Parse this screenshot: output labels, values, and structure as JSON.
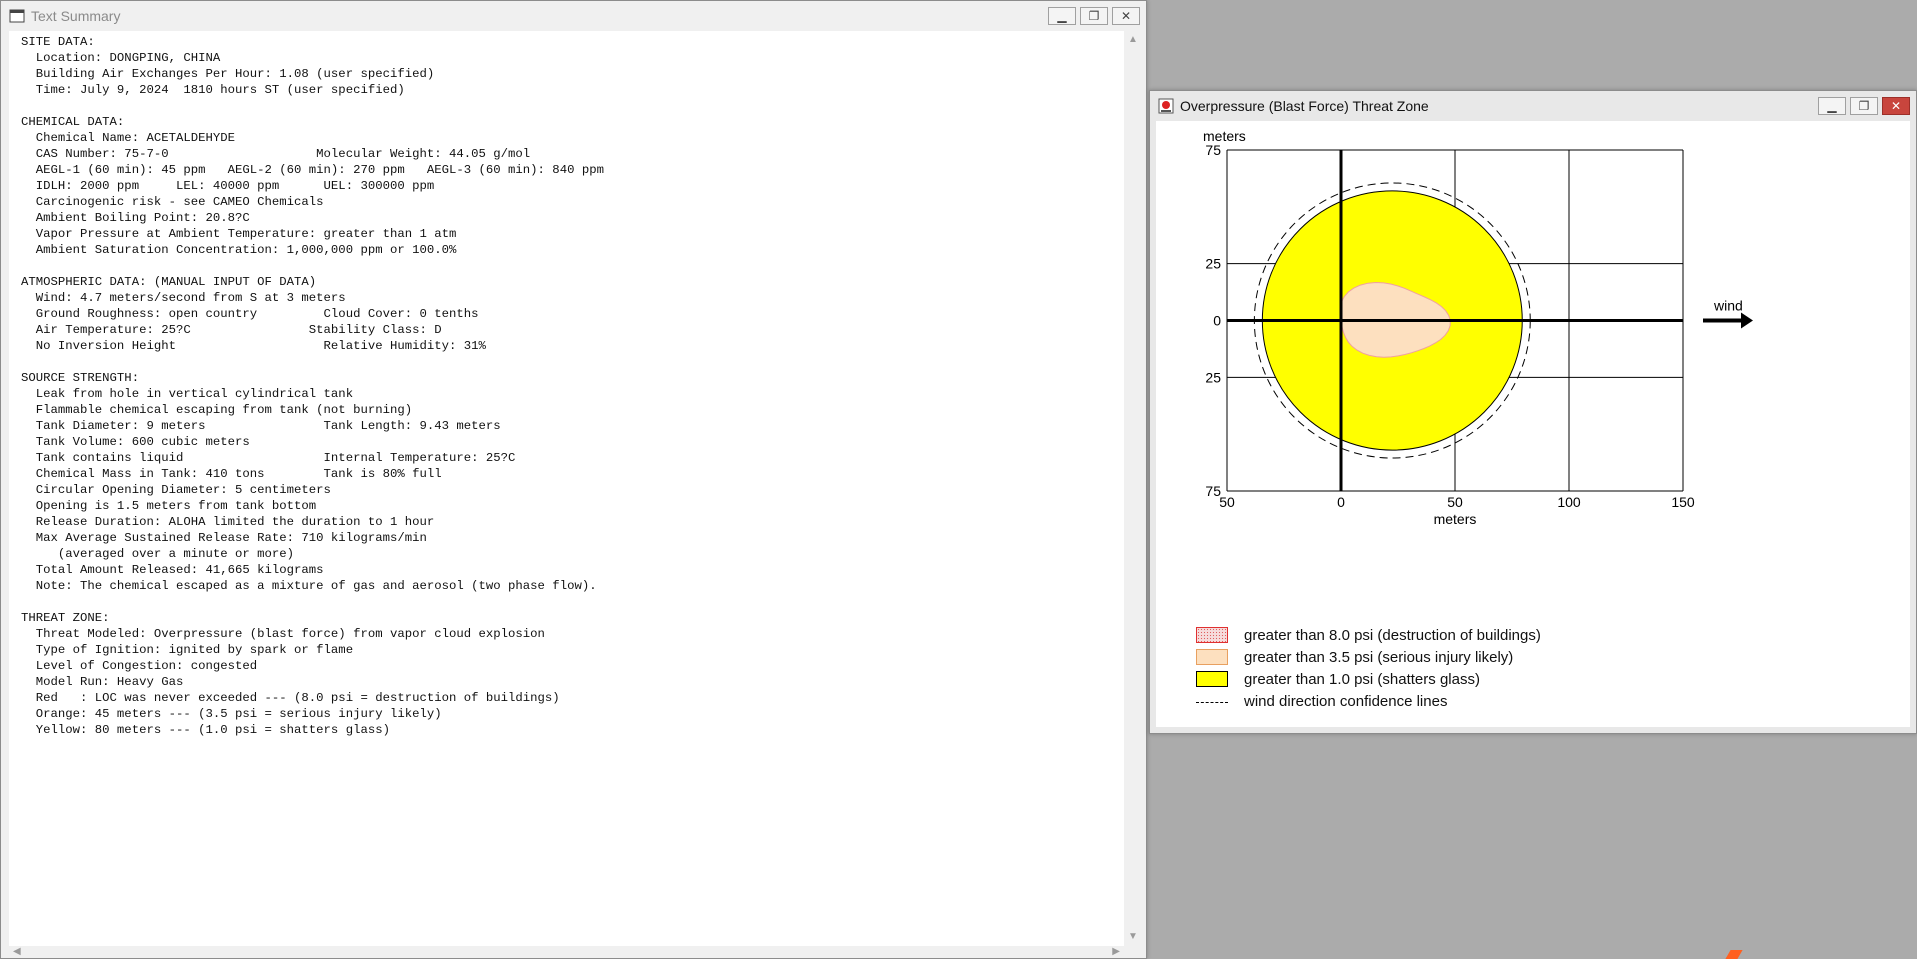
{
  "summary_window": {
    "title": "Text Summary",
    "lines": [
      "SITE DATA:",
      "  Location: DONGPING, CHINA",
      "  Building Air Exchanges Per Hour: 1.08 (user specified)",
      "  Time: July 9, 2024  1810 hours ST (user specified)",
      "",
      "CHEMICAL DATA:",
      "  Chemical Name: ACETALDEHYDE",
      "  CAS Number: 75-7-0                    Molecular Weight: 44.05 g/mol",
      "  AEGL-1 (60 min): 45 ppm   AEGL-2 (60 min): 270 ppm   AEGL-3 (60 min): 840 ppm",
      "  IDLH: 2000 ppm     LEL: 40000 ppm      UEL: 300000 ppm",
      "  Carcinogenic risk - see CAMEO Chemicals",
      "  Ambient Boiling Point: 20.8?C",
      "  Vapor Pressure at Ambient Temperature: greater than 1 atm",
      "  Ambient Saturation Concentration: 1,000,000 ppm or 100.0%",
      "",
      "ATMOSPHERIC DATA: (MANUAL INPUT OF DATA)",
      "  Wind: 4.7 meters/second from S at 3 meters",
      "  Ground Roughness: open country         Cloud Cover: 0 tenths",
      "  Air Temperature: 25?C                Stability Class: D",
      "  No Inversion Height                    Relative Humidity: 31%",
      "",
      "SOURCE STRENGTH:",
      "  Leak from hole in vertical cylindrical tank",
      "  Flammable chemical escaping from tank (not burning)",
      "  Tank Diameter: 9 meters                Tank Length: 9.43 meters",
      "  Tank Volume: 600 cubic meters",
      "  Tank contains liquid                   Internal Temperature: 25?C",
      "  Chemical Mass in Tank: 410 tons        Tank is 80% full",
      "  Circular Opening Diameter: 5 centimeters",
      "  Opening is 1.5 meters from tank bottom",
      "  Release Duration: ALOHA limited the duration to 1 hour",
      "  Max Average Sustained Release Rate: 710 kilograms/min",
      "     (averaged over a minute or more)",
      "  Total Amount Released: 41,665 kilograms",
      "  Note: The chemical escaped as a mixture of gas and aerosol (two phase flow).",
      "",
      "THREAT ZONE:",
      "  Threat Modeled: Overpressure (blast force) from vapor cloud explosion",
      "  Type of Ignition: ignited by spark or flame",
      "  Level of Congestion: congested",
      "  Model Run: Heavy Gas",
      "  Red   : LOC was never exceeded --- (8.0 psi = destruction of buildings)",
      "  Orange: 45 meters --- (3.5 psi = serious injury likely)",
      "  Yellow: 80 meters --- (1.0 psi = shatters glass)"
    ]
  },
  "threat_window": {
    "title": "Overpressure (Blast Force) Threat Zone",
    "legend": [
      {
        "label": "greater than 8.0 psi (destruction of buildings)",
        "color": "#f6dcdc",
        "border": "#e03030"
      },
      {
        "label": "greater than 3.5 psi (serious injury likely)",
        "color": "#fde0bf",
        "border": "#e8a060"
      },
      {
        "label": "greater than 1.0 psi (shatters glass)",
        "color": "#ffff00",
        "border": "#000000"
      },
      {
        "label": "wind direction confidence lines",
        "color": "",
        "border": ""
      }
    ]
  },
  "chart_data": {
    "type": "area",
    "ylabel": "meters",
    "xlabel": "meters",
    "x_ticks": [
      "50",
      "0",
      "50",
      "100",
      "150"
    ],
    "y_ticks": [
      "75",
      "25",
      "0",
      "25",
      "75"
    ],
    "xlim": [
      -50,
      150
    ],
    "ylim": [
      -75,
      75
    ],
    "gridlines_x": [
      -50,
      0,
      50,
      100,
      150
    ],
    "gridlines_y": [
      -75,
      -25,
      0,
      25,
      75
    ],
    "wind_label": "wind",
    "series": [
      {
        "name": "greater than 1.0 psi (shatters glass)",
        "center_x": 22.5,
        "center_y": 0,
        "radius": 57,
        "color": "#ffff00"
      },
      {
        "name": "greater than 3.5 psi (serious injury likely)",
        "center_x": 22,
        "center_y": 0,
        "half_width": 24,
        "half_height": 16,
        "color": "#fde0bf"
      },
      {
        "name": "wind direction confidence lines",
        "center_x": 22.5,
        "center_y": 0,
        "radius": 60.5,
        "color": "#000000"
      }
    ]
  }
}
